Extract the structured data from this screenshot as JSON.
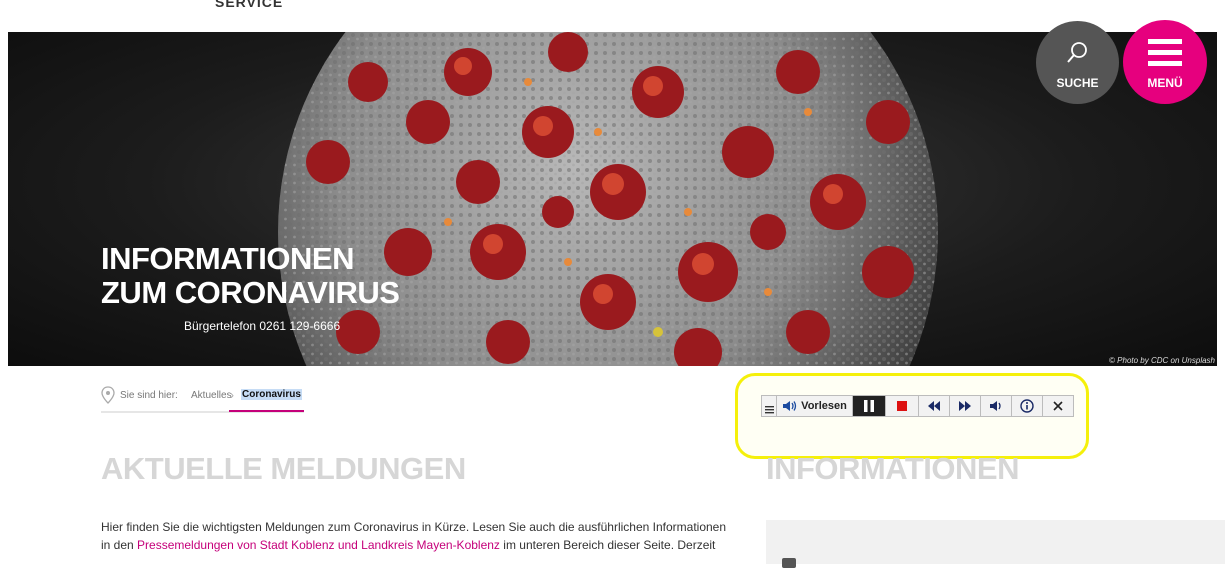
{
  "top_cut_text": "SERVICE",
  "hero": {
    "title_line1": "INFORMATIONEN",
    "title_line2": "ZUM CORONAVIRUS",
    "phone": "Bürgertelefon 0261 129-6666",
    "credit": "© Photo by CDC on Unsplash"
  },
  "header_buttons": {
    "search_label": "SUCHE",
    "menu_label": "MENÜ"
  },
  "breadcrumb": {
    "prefix": "Sie sind hier:",
    "items": [
      "Aktuelles",
      "Coronavirus"
    ]
  },
  "read_speaker": {
    "read_label": "Vorlesen",
    "icons": [
      "menu-icon",
      "speaker-icon",
      "pause-icon",
      "stop-icon",
      "rewind-icon",
      "fast-forward-icon",
      "volume-icon",
      "info-icon",
      "close-icon"
    ]
  },
  "sections": {
    "news_heading": "AKTUELLE MELDUNGEN",
    "info_heading": "INFORMATIONEN"
  },
  "body": {
    "line1": "Hier finden Sie die wichtigsten Meldungen zum Coronavirus in Kürze. Lesen Sie auch die ausführlichen Informationen",
    "line2_prefix": "in den ",
    "line2_link": "Pressemeldungen von Stadt Koblenz und Landkreis Mayen-Koblenz",
    "line2_suffix": " im unteren Bereich dieser Seite. Derzeit"
  },
  "colors": {
    "brand": "#e6007e",
    "highlight": "#f5f00a",
    "heading_gray": "#d6d6d6"
  }
}
